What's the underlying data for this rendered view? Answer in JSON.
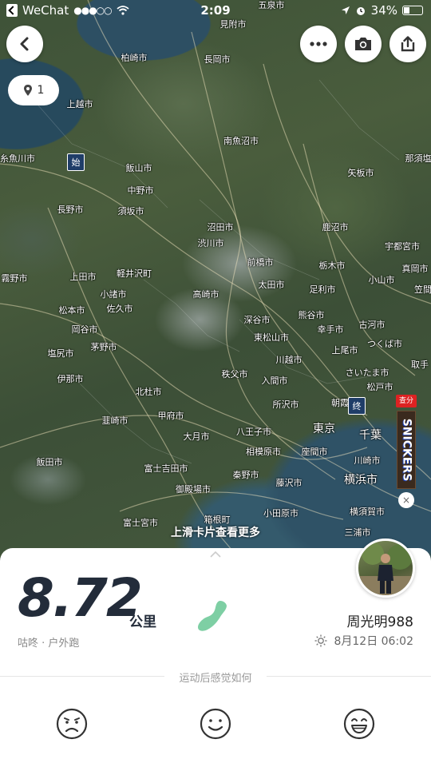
{
  "status_bar": {
    "carrier": "WeChat",
    "signal": "●●●○○",
    "time": "2:09",
    "battery": "34%"
  },
  "map": {
    "markers": {
      "start": "始",
      "end": "终"
    },
    "pin_count": "1",
    "cities": [
      "五泉市",
      "見附市",
      "柏崎市",
      "長岡市",
      "上越市",
      "糸魚川市",
      "南魚沼市",
      "矢板市",
      "那須塩",
      "飯山市",
      "中野市",
      "長野市",
      "須坂市",
      "沼田市",
      "渋川市",
      "鹿沼市",
      "宇都宮市",
      "前橋市",
      "栃木市",
      "真岡市",
      "軽井沢町",
      "上田市",
      "小諸市",
      "佐久市",
      "高崎市",
      "太田市",
      "足利市",
      "小山市",
      "笠間",
      "霧野市",
      "松本市",
      "岡谷市",
      "深谷市",
      "熊谷市",
      "幸手市",
      "古河市",
      "東松山市",
      "上尾市",
      "つくば市",
      "塩尻市",
      "茅野市",
      "川越市",
      "秩父市",
      "入間市",
      "さいたま市",
      "取手",
      "伊那市",
      "北杜市",
      "所沢市",
      "松戸市",
      "韮崎市",
      "甲府市",
      "朝霞",
      "八王子市",
      "東京",
      "大月市",
      "千葉",
      "相模原市",
      "座間市",
      "川崎市",
      "富士吉田市",
      "秦野市",
      "藤沢市",
      "横浜市",
      "飯田市",
      "御殿場市",
      "箱根町",
      "小田原市",
      "横須賀市",
      "富士宮市",
      "三浦市"
    ]
  },
  "ad": {
    "tag": "查分",
    "brand": "SNICKERS",
    "close": "×"
  },
  "hint": "上滑卡片查看更多",
  "card": {
    "distance": "8.72",
    "unit": "公里",
    "sport": "咕咚 · 户外跑",
    "username": "周光明988",
    "date": "8月12日 06:02",
    "feel_prompt": "运动后感觉如何",
    "shoe_color": "#7ecfa4"
  }
}
